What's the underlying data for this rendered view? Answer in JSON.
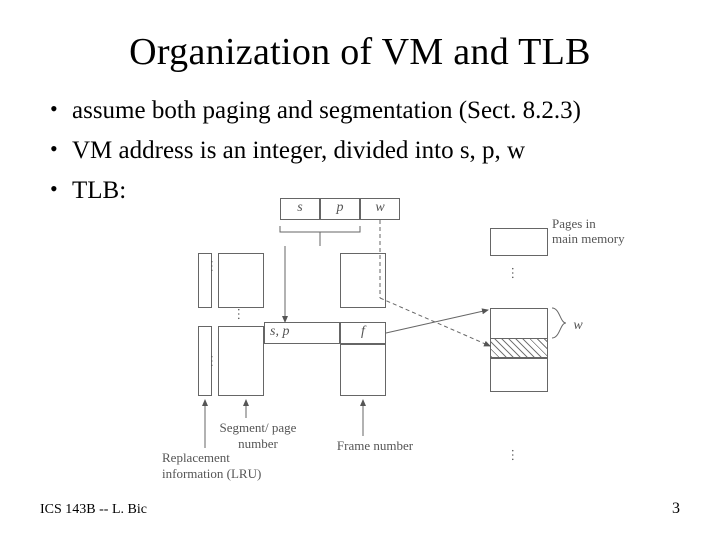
{
  "title": "Organization of VM and TLB",
  "bullets": [
    "assume both paging and segmentation (Sect. 8.2.3)",
    "VM address is an integer, divided into s, p, w",
    "TLB:"
  ],
  "diagram": {
    "addr_fields": {
      "s": "s",
      "p": "p",
      "w": "w"
    },
    "tlb_columns_label": "s, p",
    "tlb_value_label": "f",
    "seg_page_label": "Segment/ page number",
    "replacement_label": "Replacement information (LRU)",
    "frame_number_label": "Frame number",
    "mem_label_line1": "Pages in",
    "mem_label_line2": "main memory",
    "w_brace_label": "w",
    "vdots": "…"
  },
  "footer": {
    "left": "ICS 143B -- L. Bic",
    "page": "3"
  }
}
